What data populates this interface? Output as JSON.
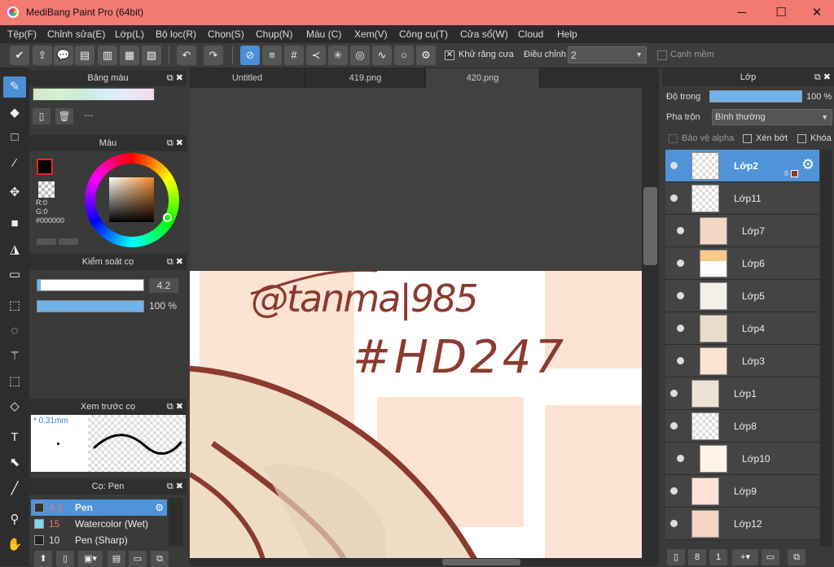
{
  "window": {
    "title": "MediBang Paint Pro (64bit)",
    "minimize": "─",
    "maximize": "☐",
    "close": "✕"
  },
  "menu": [
    "Tệp(F)",
    "Chỉnh sửa(E)",
    "Lớp(L)",
    "Bộ lọc(R)",
    "Chọn(S)",
    "Chụp(N)",
    "Màu (C)",
    "Xem(V)",
    "Công cụ(T)",
    "Cửa sổ(W)",
    "Cloud",
    "Help"
  ],
  "toolbar": {
    "antialias_label": "Khử răng cưa",
    "correction_label": "Điều chỉnh",
    "correction_value": "2",
    "soft_edge_label": "Cạnh mềm"
  },
  "tabs": [
    "Untitled",
    "419.png",
    "420.png"
  ],
  "palette_panel": {
    "title": "Bảng màu",
    "swatch_label": "---"
  },
  "color_panel": {
    "title": "Màu",
    "r": "R:0",
    "g": "G:0",
    "hex": "#000000"
  },
  "brush_control": {
    "title": "Kiểm soát cọ",
    "size": "4.2",
    "opacity": "100 %",
    "size_fraction": 0.03,
    "opacity_fraction": 1.0
  },
  "brush_preview": {
    "title": "Xem trước cọ",
    "size": "* 0.31mm"
  },
  "brush_list": {
    "title": "Cọ: Pen",
    "items": [
      {
        "size": "4.2",
        "name": "Pen",
        "selected": true,
        "color": "#333333"
      },
      {
        "size": "15",
        "name": "Watercolor (Wet)",
        "selected": false,
        "color": "#7fd8f0"
      },
      {
        "size": "10",
        "name": "Pen (Sharp)",
        "selected": false,
        "color": "#222222"
      }
    ]
  },
  "layer_panel": {
    "title": "Lớp",
    "opacity_label": "Độ trong",
    "opacity_value": "100 %",
    "blend_label": "Pha trộn",
    "blend_value": "Bình thường",
    "protect_alpha": "Bảo vệ alpha",
    "clip": "Xén bớt",
    "lock": "Khóa",
    "selected_badge": "8"
  },
  "layers": [
    {
      "name": "Lớp2",
      "selected": true,
      "indent": false
    },
    {
      "name": "Lớp11",
      "selected": false,
      "indent": false
    },
    {
      "name": "Lớp7",
      "selected": false,
      "indent": true
    },
    {
      "name": "Lớp6",
      "selected": false,
      "indent": true
    },
    {
      "name": "Lớp5",
      "selected": false,
      "indent": true
    },
    {
      "name": "Lớp4",
      "selected": false,
      "indent": true
    },
    {
      "name": "Lớp3",
      "selected": false,
      "indent": true
    },
    {
      "name": "Lớp1",
      "selected": false,
      "indent": false
    },
    {
      "name": "Lớp8",
      "selected": false,
      "indent": false
    },
    {
      "name": "Lớp10",
      "selected": false,
      "indent": true
    },
    {
      "name": "Lớp9",
      "selected": false,
      "indent": false
    },
    {
      "name": "Lớp12",
      "selected": false,
      "indent": false
    }
  ],
  "colors": {
    "accent": "#4b8fd6",
    "titlebar": "#f37a73",
    "ink": "#8b3a2e",
    "peach": "#fde3d3"
  }
}
